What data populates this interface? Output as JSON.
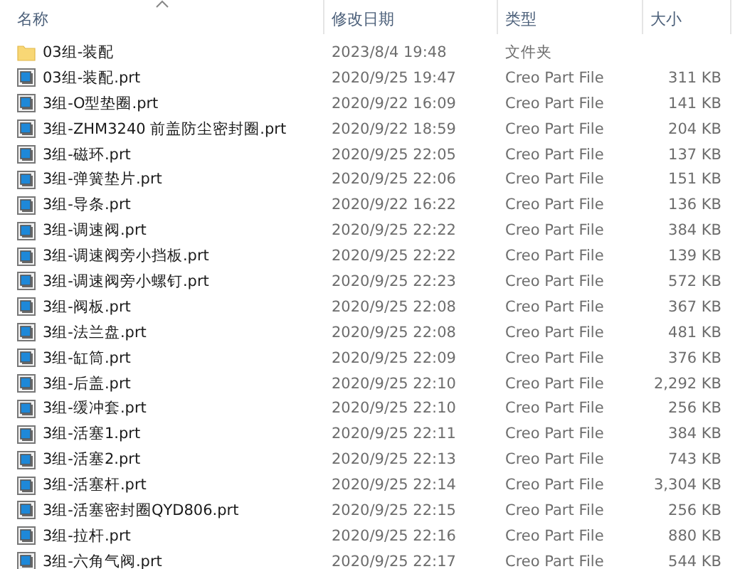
{
  "columns": [
    {
      "label": "名称",
      "sorted": true
    },
    {
      "label": "修改日期",
      "sorted": false
    },
    {
      "label": "类型",
      "sorted": false
    },
    {
      "label": "大小",
      "sorted": false
    }
  ],
  "rows": [
    {
      "kind": "folder",
      "name": "03组-装配",
      "date": "2023/8/4 19:48",
      "type": "文件夹"
    },
    {
      "kind": "file",
      "name": "03组-装配.prt",
      "date": "2020/9/25 19:47",
      "type": "Creo Part File",
      "size": "311 KB"
    },
    {
      "kind": "file",
      "name": "3组-O型垫圈.prt",
      "date": "2020/9/22 16:09",
      "type": "Creo Part File",
      "size": "141 KB"
    },
    {
      "kind": "file",
      "name": "3组-ZHM3240 前盖防尘密封圈.prt",
      "date": "2020/9/22 18:59",
      "type": "Creo Part File",
      "size": "204 KB"
    },
    {
      "kind": "file",
      "name": "3组-磁环.prt",
      "date": "2020/9/25 22:05",
      "type": "Creo Part File",
      "size": "137 KB"
    },
    {
      "kind": "file",
      "name": "3组-弹簧垫片.prt",
      "date": "2020/9/25 22:06",
      "type": "Creo Part File",
      "size": "151 KB"
    },
    {
      "kind": "file",
      "name": "3组-导条.prt",
      "date": "2020/9/22 16:22",
      "type": "Creo Part File",
      "size": "136 KB"
    },
    {
      "kind": "file",
      "name": "3组-调速阀.prt",
      "date": "2020/9/25 22:22",
      "type": "Creo Part File",
      "size": "384 KB"
    },
    {
      "kind": "file",
      "name": "3组-调速阀旁小挡板.prt",
      "date": "2020/9/25 22:22",
      "type": "Creo Part File",
      "size": "139 KB"
    },
    {
      "kind": "file",
      "name": "3组-调速阀旁小螺钉.prt",
      "date": "2020/9/25 22:23",
      "type": "Creo Part File",
      "size": "572 KB"
    },
    {
      "kind": "file",
      "name": "3组-阀板.prt",
      "date": "2020/9/25 22:08",
      "type": "Creo Part File",
      "size": "367 KB"
    },
    {
      "kind": "file",
      "name": "3组-法兰盘.prt",
      "date": "2020/9/25 22:08",
      "type": "Creo Part File",
      "size": "481 KB"
    },
    {
      "kind": "file",
      "name": "3组-缸筒.prt",
      "date": "2020/9/25 22:09",
      "type": "Creo Part File",
      "size": "376 KB"
    },
    {
      "kind": "file",
      "name": "3组-后盖.prt",
      "date": "2020/9/25 22:10",
      "type": "Creo Part File",
      "size": "2,292 KB"
    },
    {
      "kind": "file",
      "name": "3组-缓冲套.prt",
      "date": "2020/9/25 22:10",
      "type": "Creo Part File",
      "size": "256 KB"
    },
    {
      "kind": "file",
      "name": "3组-活塞1.prt",
      "date": "2020/9/25 22:11",
      "type": "Creo Part File",
      "size": "384 KB"
    },
    {
      "kind": "file",
      "name": "3组-活塞2.prt",
      "date": "2020/9/25 22:13",
      "type": "Creo Part File",
      "size": "743 KB"
    },
    {
      "kind": "file",
      "name": "3组-活塞杆.prt",
      "date": "2020/9/25 22:14",
      "type": "Creo Part File",
      "size": "3,304 KB"
    },
    {
      "kind": "file",
      "name": "3组-活塞密封圈QYD806.prt",
      "date": "2020/9/25 22:15",
      "type": "Creo Part File",
      "size": "256 KB"
    },
    {
      "kind": "file",
      "name": "3组-拉杆.prt",
      "date": "2020/9/25 22:16",
      "type": "Creo Part File",
      "size": "880 KB"
    },
    {
      "kind": "file",
      "name": "3组-六角气阀.prt",
      "date": "2020/9/25 22:17",
      "type": "Creo Part File",
      "size": "544 KB"
    }
  ]
}
